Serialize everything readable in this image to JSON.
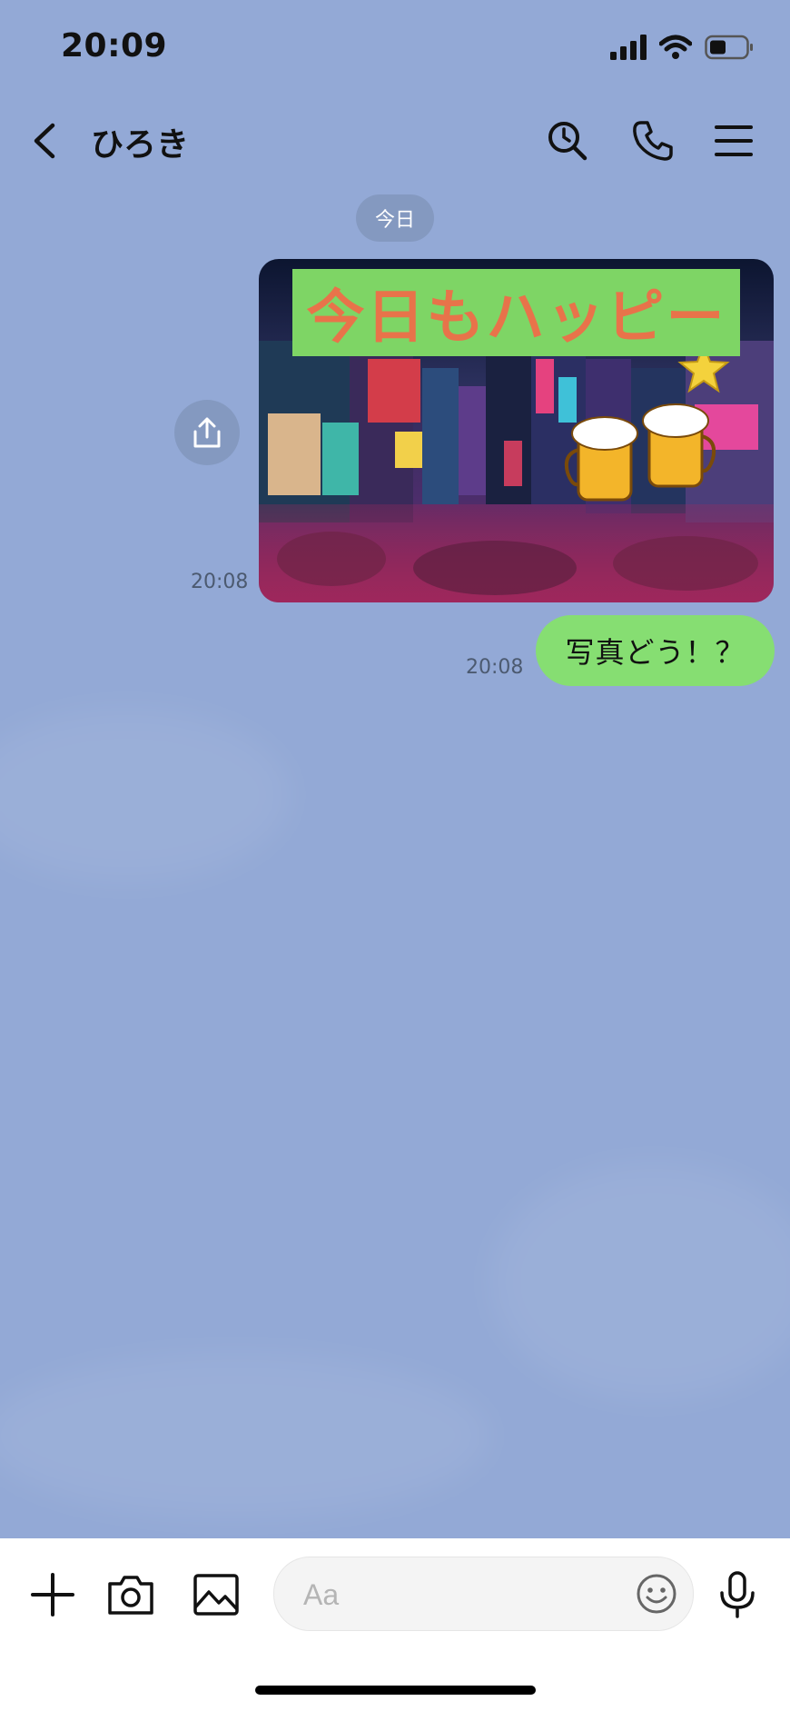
{
  "status_bar": {
    "time": "20:09"
  },
  "header": {
    "contact_name": "ひろき"
  },
  "date_separator": "今日",
  "messages": [
    {
      "type": "image",
      "banner_text": "今日もハッピー",
      "time": "20:08"
    },
    {
      "type": "text",
      "text": "写真どう！？",
      "time": "20:08"
    }
  ],
  "input": {
    "placeholder": "Aa"
  },
  "colors": {
    "background": "#93a9d6",
    "bubble_green": "#86de72",
    "banner_green": "#7ed565",
    "banner_text": "#e8734a"
  }
}
